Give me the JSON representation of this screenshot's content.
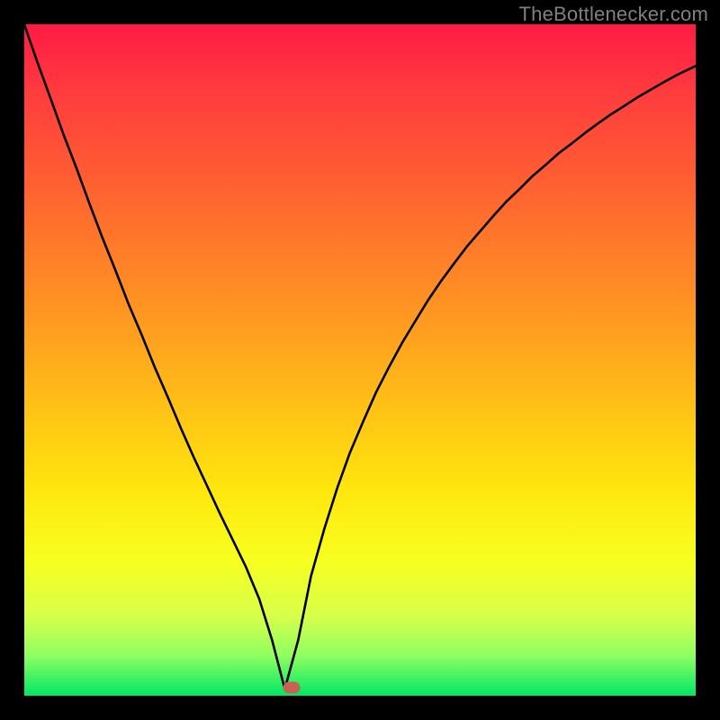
{
  "watermark": "TheBottlenecker.com",
  "chart_data": {
    "type": "line",
    "title": "",
    "xlabel": "",
    "ylabel": "",
    "xlim": [
      0,
      1
    ],
    "ylim": [
      0,
      1
    ],
    "note": "Axes have no tick labels in the image; x and y are normalized 0–1 as implied by the plot area. The curve is a V-shaped bottleneck curve reaching ~0 at x≈0.388.",
    "min_x": 0.388,
    "min_y": 0.0,
    "marker": {
      "x": 0.398,
      "y": 0.012,
      "color": "#c86255"
    },
    "series": [
      {
        "name": "bottleneck-curve",
        "color": "#000000",
        "x": [
          0.0,
          0.019,
          0.039,
          0.058,
          0.078,
          0.097,
          0.116,
          0.136,
          0.155,
          0.175,
          0.194,
          0.214,
          0.233,
          0.252,
          0.272,
          0.291,
          0.311,
          0.33,
          0.35,
          0.369,
          0.388,
          0.408,
          0.427,
          0.447,
          0.466,
          0.485,
          0.505,
          0.524,
          0.544,
          0.563,
          0.583,
          0.602,
          0.621,
          0.641,
          0.66,
          0.68,
          0.699,
          0.718,
          0.738,
          0.757,
          0.777,
          0.796,
          0.816,
          0.835,
          0.854,
          0.874,
          0.893,
          0.913,
          0.932,
          0.951,
          0.971,
          1.0
        ],
        "y": [
          1.0,
          0.945,
          0.89,
          0.837,
          0.785,
          0.733,
          0.683,
          0.633,
          0.584,
          0.537,
          0.49,
          0.444,
          0.399,
          0.356,
          0.313,
          0.272,
          0.231,
          0.192,
          0.144,
          0.083,
          0.01,
          0.083,
          0.178,
          0.249,
          0.309,
          0.362,
          0.409,
          0.452,
          0.491,
          0.526,
          0.559,
          0.59,
          0.618,
          0.645,
          0.67,
          0.693,
          0.715,
          0.736,
          0.755,
          0.774,
          0.791,
          0.808,
          0.823,
          0.838,
          0.852,
          0.866,
          0.878,
          0.891,
          0.902,
          0.913,
          0.924,
          0.938
        ]
      }
    ]
  }
}
